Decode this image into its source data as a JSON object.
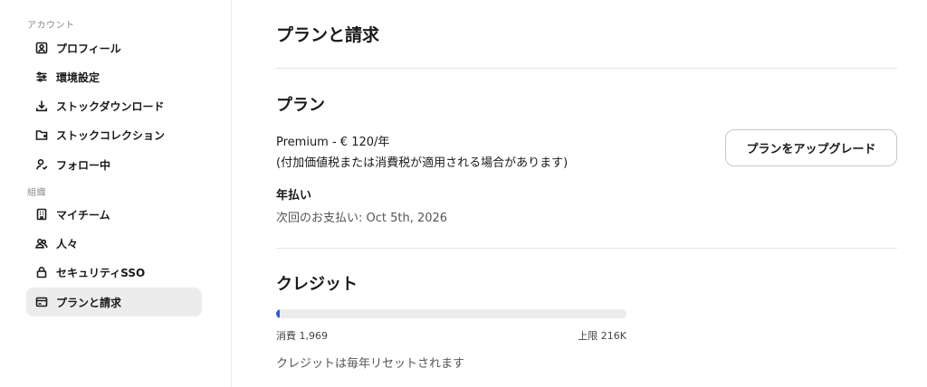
{
  "sidebar": {
    "sections": [
      {
        "label": "アカウント"
      },
      {
        "label": "組織"
      }
    ],
    "items": [
      {
        "label": "プロフィール",
        "icon": "profile-icon",
        "active": false
      },
      {
        "label": "環境設定",
        "icon": "sliders-icon",
        "active": false
      },
      {
        "label": "ストックダウンロード",
        "icon": "download-icon",
        "active": false
      },
      {
        "label": "ストックコレクション",
        "icon": "folder-icon",
        "active": false
      },
      {
        "label": "フォロー中",
        "icon": "user-follow-icon",
        "active": false
      },
      {
        "label": "マイチーム",
        "icon": "building-icon",
        "active": false
      },
      {
        "label": "人々",
        "icon": "people-icon",
        "active": false
      },
      {
        "label": "セキュリティSSO",
        "icon": "lock-icon",
        "active": false
      },
      {
        "label": "プランと請求",
        "icon": "card-icon",
        "active": true
      }
    ]
  },
  "main": {
    "title": "プランと請求",
    "plan": {
      "heading": "プラン",
      "name_price": "Premium - € 120/年",
      "tax_note": "(付加価値税または消費税が適用される場合があります)",
      "upgrade_label": "プランをアップグレード",
      "billing_cycle": "年払い",
      "next_payment": "次回のお支払い: Oct 5th, 2026"
    },
    "credits": {
      "heading": "クレジット",
      "used_label": "消費 1,969",
      "limit_label": "上限 216K",
      "used_fraction": 0.009,
      "reset_note": "クレジットは毎年リセットされます"
    }
  },
  "colors": {
    "accent": "#2f5bd9",
    "active_bg": "#ececec",
    "divider": "#e4e4e4"
  }
}
